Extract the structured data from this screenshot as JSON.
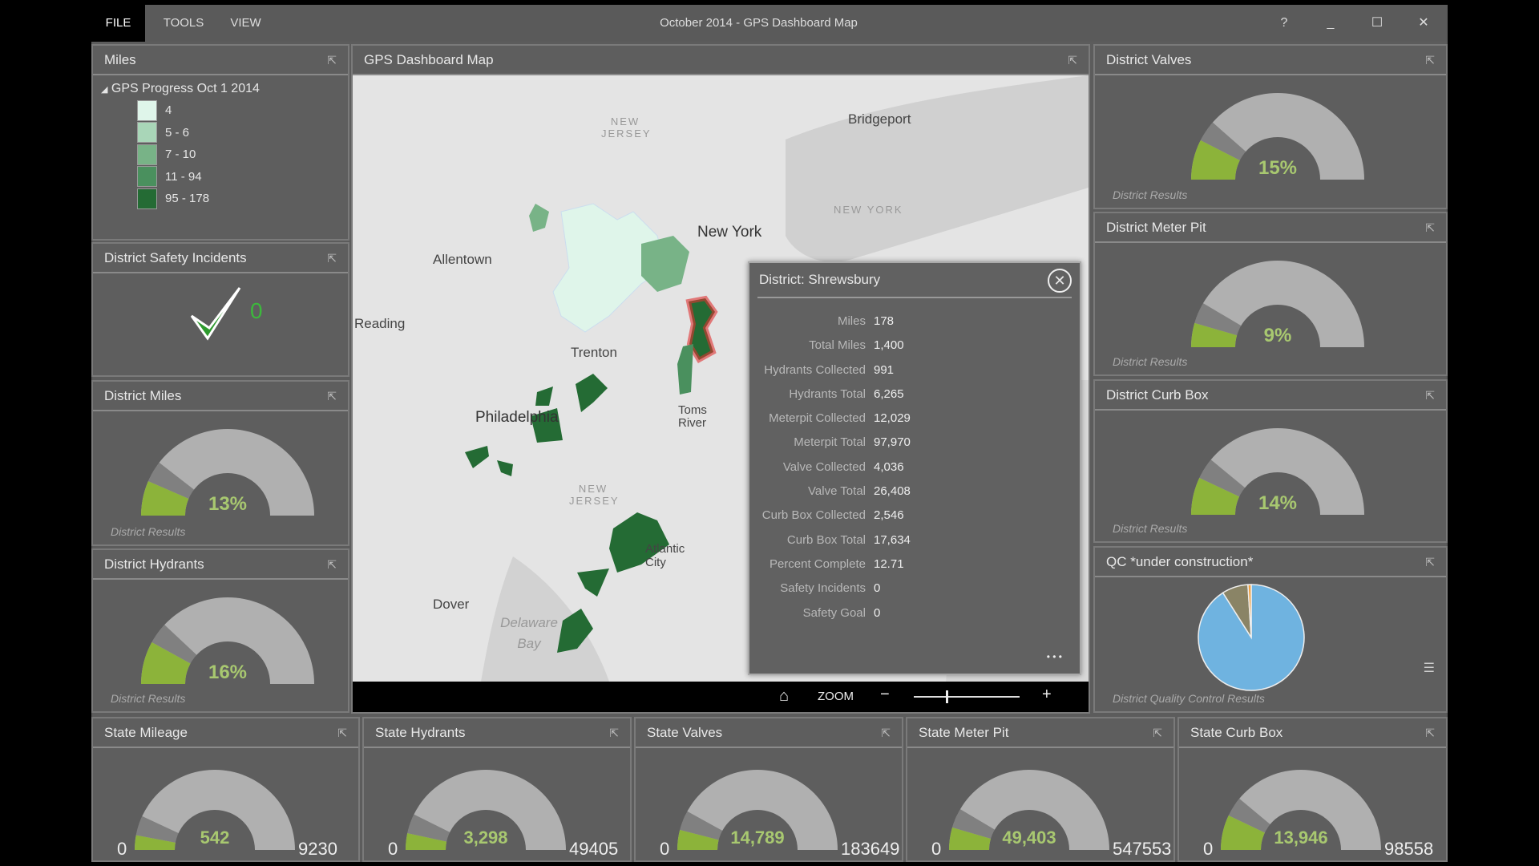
{
  "window": {
    "title": "October 2014 - GPS Dashboard Map",
    "menu": [
      "FILE",
      "TOOLS",
      "VIEW"
    ],
    "controls": [
      "?",
      "_",
      "☐",
      "✕"
    ]
  },
  "miles": {
    "title": "Miles",
    "layer": "GPS Progress Oct 1 2014",
    "legend": [
      {
        "label": "4",
        "color": "#dff5ea"
      },
      {
        "label": "5 - 6",
        "color": "#a9d6b8"
      },
      {
        "label": "7 - 10",
        "color": "#78b387"
      },
      {
        "label": "11 - 94",
        "color": "#4a905e"
      },
      {
        "label": "95 - 178",
        "color": "#246b34"
      }
    ]
  },
  "safety": {
    "title": "District Safety Incidents",
    "value": "0"
  },
  "district_gauges": [
    {
      "id": "district-miles",
      "title": "District Miles",
      "percent": 13,
      "label": "13%",
      "sub": "District Results"
    },
    {
      "id": "district-hydrants",
      "title": "District Hydrants",
      "percent": 16,
      "label": "16%",
      "sub": "District Results"
    },
    {
      "id": "district-valves",
      "title": "District Valves",
      "percent": 15,
      "label": "15%",
      "sub": "District Results"
    },
    {
      "id": "district-meter-pit",
      "title": "District Meter Pit",
      "percent": 9,
      "label": "9%",
      "sub": "District Results"
    },
    {
      "id": "district-curb-box",
      "title": "District Curb Box",
      "percent": 14,
      "label": "14%",
      "sub": "District Results"
    }
  ],
  "map": {
    "title": "GPS Dashboard Map",
    "labels": [
      "Bridgeport",
      "NEW JERSEY",
      "NEW YORK",
      "New York",
      "Allentown",
      "Reading",
      "Trenton",
      "Philadelphia",
      "Toms River",
      "NEW JERSEY",
      "Atlantic City",
      "Dover",
      "Delaware Bay"
    ],
    "zoom_label": "ZOOM",
    "zoom_level": 0.3
  },
  "popup": {
    "title": "District: Shrewsbury",
    "rows": [
      {
        "k": "Miles",
        "v": "178"
      },
      {
        "k": "Total Miles",
        "v": "1,400"
      },
      {
        "k": "Hydrants Collected",
        "v": "991"
      },
      {
        "k": "Hydrants Total",
        "v": "6,265"
      },
      {
        "k": "Meterpit Collected",
        "v": "12,029"
      },
      {
        "k": "Meterpit Total",
        "v": "97,970"
      },
      {
        "k": "Valve Collected",
        "v": "4,036"
      },
      {
        "k": "Valve Total",
        "v": "26,408"
      },
      {
        "k": "Curb Box Collected",
        "v": "2,546"
      },
      {
        "k": "Curb Box Total",
        "v": "17,634"
      },
      {
        "k": "Percent Complete",
        "v": "12.71"
      },
      {
        "k": "Safety Incidents",
        "v": "0"
      },
      {
        "k": "Safety Goal",
        "v": "0"
      }
    ],
    "more": "• • •"
  },
  "qc": {
    "title": "QC *under construction*",
    "sub": "District Quality Control Results",
    "slices": [
      {
        "value": 0.91,
        "color": "#6fb3e0"
      },
      {
        "value": 0.08,
        "color": "#8a8466"
      },
      {
        "value": 0.01,
        "color": "#f0a040"
      }
    ]
  },
  "state_gauges": [
    {
      "id": "state-mileage",
      "title": "State Mileage",
      "value": 542,
      "label": "542",
      "min": "0",
      "max": "9230"
    },
    {
      "id": "state-hydrants",
      "title": "State Hydrants",
      "value": 3298,
      "label": "3,298",
      "min": "0",
      "max": "49405"
    },
    {
      "id": "state-valves",
      "title": "State Valves",
      "value": 14789,
      "label": "14,789",
      "min": "0",
      "max": "183649"
    },
    {
      "id": "state-meter-pit",
      "title": "State Meter Pit",
      "value": 49403,
      "label": "49,403",
      "min": "0",
      "max": "547553"
    },
    {
      "id": "state-curb-box",
      "title": "State Curb Box",
      "value": 13946,
      "label": "13,946",
      "min": "0",
      "max": "98558"
    }
  ],
  "colors": {
    "gauge_fill": "#8cb33a",
    "gauge_track": "#b0b0b0",
    "gauge_text": "#a8c870",
    "highlight": "#e03030"
  }
}
